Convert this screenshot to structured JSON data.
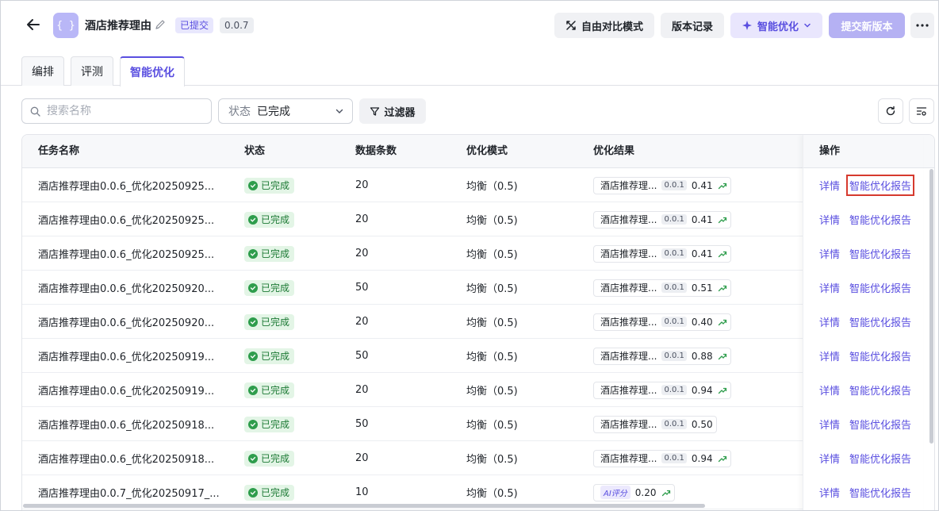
{
  "header": {
    "title": "酒店推荐理由",
    "app_icon_text": "{ }",
    "status_tag": "已提交",
    "version": "0.0.7",
    "buttons": {
      "compare": "自由对比模式",
      "history": "版本记录",
      "optimize": "智能优化",
      "submit": "提交新版本"
    }
  },
  "tabs": [
    "编排",
    "评测",
    "智能优化"
  ],
  "active_tab": "智能优化",
  "toolbar": {
    "search_placeholder": "搜索名称",
    "status_label": "状态",
    "status_value": "已完成",
    "filter_label": "过滤器"
  },
  "table": {
    "columns": [
      "任务名称",
      "状态",
      "数据条数",
      "优化模式",
      "优化结果",
      "操作"
    ],
    "rows": [
      {
        "name": "酒店推荐理由0.0.6_优化20250925...",
        "status": "已完成",
        "count": "20",
        "mode": "均衡（0.5)",
        "result_name": "酒店推荐理...",
        "result_version": "0.0.1",
        "score": "0.41",
        "trend_up": true,
        "ai": false
      },
      {
        "name": "酒店推荐理由0.0.6_优化20250925...",
        "status": "已完成",
        "count": "20",
        "mode": "均衡（0.5)",
        "result_name": "酒店推荐理...",
        "result_version": "0.0.1",
        "score": "0.41",
        "trend_up": true,
        "ai": false
      },
      {
        "name": "酒店推荐理由0.0.6_优化20250925...",
        "status": "已完成",
        "count": "20",
        "mode": "均衡（0.5)",
        "result_name": "酒店推荐理...",
        "result_version": "0.0.1",
        "score": "0.41",
        "trend_up": true,
        "ai": false
      },
      {
        "name": "酒店推荐理由0.0.6_优化20250920...",
        "status": "已完成",
        "count": "50",
        "mode": "均衡（0.5)",
        "result_name": "酒店推荐理...",
        "result_version": "0.0.1",
        "score": "0.51",
        "trend_up": true,
        "ai": false
      },
      {
        "name": "酒店推荐理由0.0.6_优化20250920...",
        "status": "已完成",
        "count": "20",
        "mode": "均衡（0.5)",
        "result_name": "酒店推荐理...",
        "result_version": "0.0.1",
        "score": "0.40",
        "trend_up": true,
        "ai": false
      },
      {
        "name": "酒店推荐理由0.0.6_优化20250919...",
        "status": "已完成",
        "count": "50",
        "mode": "均衡（0.5)",
        "result_name": "酒店推荐理...",
        "result_version": "0.0.1",
        "score": "0.88",
        "trend_up": true,
        "ai": false
      },
      {
        "name": "酒店推荐理由0.0.6_优化20250919...",
        "status": "已完成",
        "count": "20",
        "mode": "均衡（0.5)",
        "result_name": "酒店推荐理...",
        "result_version": "0.0.1",
        "score": "0.94",
        "trend_up": true,
        "ai": false
      },
      {
        "name": "酒店推荐理由0.0.6_优化20250918...",
        "status": "已完成",
        "count": "50",
        "mode": "均衡（0.5)",
        "result_name": "酒店推荐理...",
        "result_version": "0.0.1",
        "score": "0.50",
        "trend_up": false,
        "ai": false
      },
      {
        "name": "酒店推荐理由0.0.6_优化20250918...",
        "status": "已完成",
        "count": "20",
        "mode": "均衡（0.5)",
        "result_name": "酒店推荐理...",
        "result_version": "0.0.1",
        "score": "0.94",
        "trend_up": true,
        "ai": false
      },
      {
        "name": "酒店推荐理由0.0.7_优化20250917_...",
        "status": "已完成",
        "count": "10",
        "mode": "均衡（0.5)",
        "result_name": "",
        "result_version": "",
        "score": "0.20",
        "trend_up": true,
        "ai": true,
        "ai_label": "AI评分"
      }
    ],
    "actions": {
      "detail": "详情",
      "report": "智能优化报告"
    },
    "highlighted_row": 0
  },
  "colors": {
    "accent": "#5a4fe0",
    "success": "#2e9d4c",
    "highlight_box": "#d63a2e"
  }
}
